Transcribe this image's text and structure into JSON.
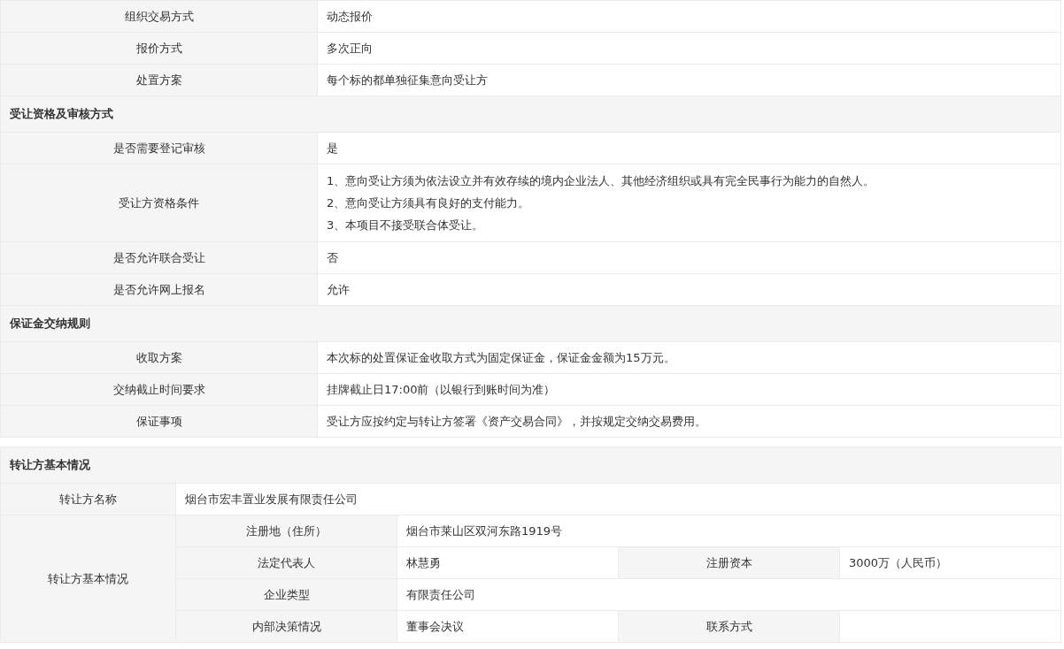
{
  "blocks": [
    {
      "rows": [
        {
          "label": "组织交易方式",
          "values": [
            "动态报价"
          ]
        },
        {
          "label": "报价方式",
          "values": [
            "多次正向"
          ]
        },
        {
          "label": "处置方案",
          "values": [
            "每个标的都单独征集意向受让方"
          ]
        }
      ]
    },
    {
      "title": "受让资格及审核方式",
      "rows": [
        {
          "label": "是否需要登记审核",
          "values": [
            "是"
          ]
        },
        {
          "label": "受让方资格条件",
          "values": [
            "1、意向受让方须为依法设立并有效存续的境内企业法人、其他经济组织或具有完全民事行为能力的自然人。",
            "2、意向受让方须具有良好的支付能力。",
            "3、本项目不接受联合体受让。"
          ]
        },
        {
          "label": "是否允许联合受让",
          "values": [
            "否"
          ]
        },
        {
          "label": "是否允许网上报名",
          "values": [
            "允许"
          ]
        }
      ]
    },
    {
      "title": "保证金交纳规则",
      "rows": [
        {
          "label": "收取方案",
          "values": [
            "本次标的处置保证金收取方式为固定保证金，保证金金额为15万元。"
          ]
        },
        {
          "label": "交纳截止时间要求",
          "values": [
            "挂牌截止日17:00前（以银行到账时间为准）"
          ]
        },
        {
          "label": "保证事项",
          "values": [
            "受让方应按约定与转让方签署《资产交易合同》，并按规定交纳交易费用。"
          ]
        }
      ]
    }
  ],
  "transferor": {
    "title": "转让方基本情况",
    "name_label": "转让方名称",
    "name": "烟台市宏丰置业发展有限责任公司",
    "info_label": "转让方基本情况",
    "info_rows": [
      {
        "fields": [
          {
            "label": "注册地（住所）",
            "value": "烟台市莱山区双河东路1919号"
          }
        ]
      },
      {
        "fields": [
          {
            "label": "法定代表人",
            "value": "林慧勇"
          },
          {
            "label": "注册资本",
            "value": "3000万（人民币）"
          }
        ]
      },
      {
        "fields": [
          {
            "label": "企业类型",
            "value": "有限责任公司"
          }
        ]
      },
      {
        "fields": [
          {
            "label": "内部决策情况",
            "value": "董事会决议"
          },
          {
            "label": "联系方式"
          }
        ]
      }
    ]
  }
}
